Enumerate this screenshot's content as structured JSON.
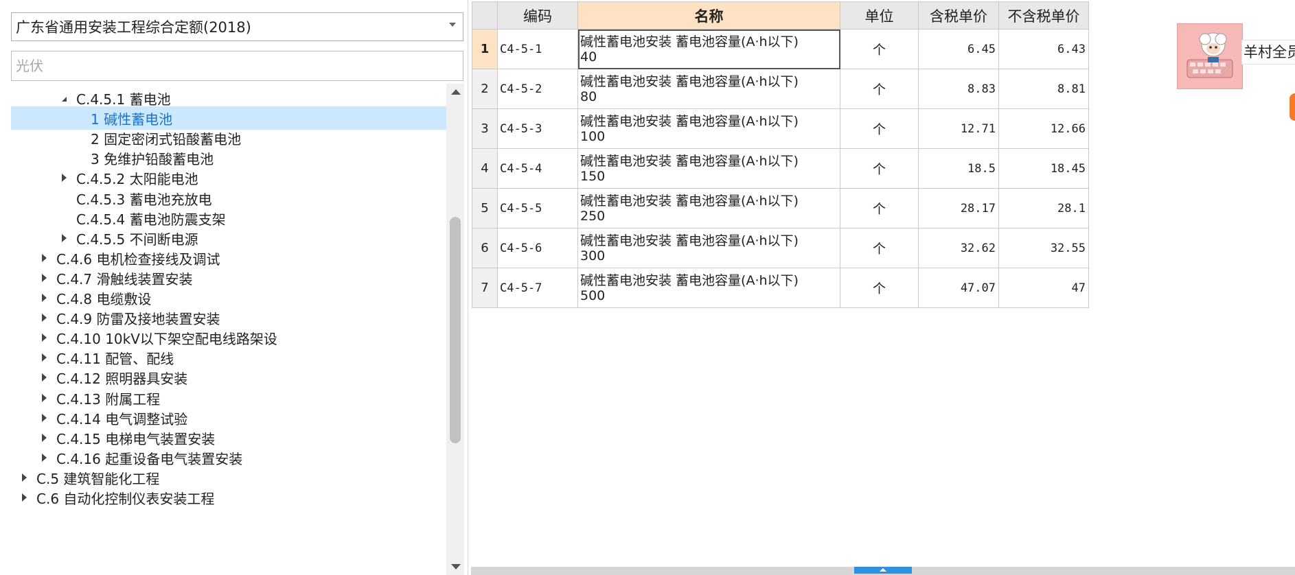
{
  "library_select": {
    "value": "广东省通用安装工程综合定额(2018)"
  },
  "search": {
    "placeholder": "光伏",
    "value": ""
  },
  "tree": {
    "items": [
      {
        "label": "C.4.5.1 蓄电池",
        "level": 2,
        "state": "expanded"
      },
      {
        "label": "1 碱性蓄电池",
        "level": 3,
        "state": "none",
        "selected": true
      },
      {
        "label": "2 固定密闭式铅酸蓄电池",
        "level": 3,
        "state": "none"
      },
      {
        "label": "3 免维护铅酸蓄电池",
        "level": 3,
        "state": "none"
      },
      {
        "label": "C.4.5.2 太阳能电池",
        "level": 2,
        "state": "collapsed"
      },
      {
        "label": "C.4.5.3 蓄电池充放电",
        "level": 2,
        "state": "none"
      },
      {
        "label": "C.4.5.4 蓄电池防震支架",
        "level": 2,
        "state": "none"
      },
      {
        "label": "C.4.5.5 不间断电源",
        "level": 2,
        "state": "collapsed"
      },
      {
        "label": "C.4.6 电机检查接线及调试",
        "level": 1,
        "state": "collapsed"
      },
      {
        "label": "C.4.7 滑触线装置安装",
        "level": 1,
        "state": "collapsed"
      },
      {
        "label": "C.4.8 电缆敷设",
        "level": 1,
        "state": "collapsed"
      },
      {
        "label": "C.4.9 防雷及接地装置安装",
        "level": 1,
        "state": "collapsed"
      },
      {
        "label": "C.4.10 10kV以下架空配电线路架设",
        "level": 1,
        "state": "collapsed"
      },
      {
        "label": "C.4.11 配管、配线",
        "level": 1,
        "state": "collapsed"
      },
      {
        "label": "C.4.12 照明器具安装",
        "level": 1,
        "state": "collapsed"
      },
      {
        "label": "C.4.13 附属工程",
        "level": 1,
        "state": "collapsed"
      },
      {
        "label": "C.4.14 电气调整试验",
        "level": 1,
        "state": "collapsed"
      },
      {
        "label": "C.4.15 电梯电气装置安装",
        "level": 1,
        "state": "collapsed"
      },
      {
        "label": "C.4.16 起重设备电气装置安装",
        "level": 1,
        "state": "collapsed"
      },
      {
        "label": "C.5 建筑智能化工程",
        "level": 0,
        "state": "collapsed"
      },
      {
        "label": "C.6 自动化控制仪表安装工程",
        "level": 0,
        "state": "collapsed"
      }
    ]
  },
  "table": {
    "columns": [
      "",
      "编码",
      "名称",
      "单位",
      "含税单价",
      "不含税单价"
    ],
    "rows": [
      {
        "num": "1",
        "code": "C4-5-1",
        "name_line1": "碱性蓄电池安装 蓄电池容量(A·h以下)",
        "name_line2": "40",
        "unit": "个",
        "price_tax": "6.45",
        "price_notax": "6.43"
      },
      {
        "num": "2",
        "code": "C4-5-2",
        "name_line1": "碱性蓄电池安装 蓄电池容量(A·h以下)",
        "name_line2": "80",
        "unit": "个",
        "price_tax": "8.83",
        "price_notax": "8.81"
      },
      {
        "num": "3",
        "code": "C4-5-3",
        "name_line1": "碱性蓄电池安装 蓄电池容量(A·h以下)",
        "name_line2": "100",
        "unit": "个",
        "price_tax": "12.71",
        "price_notax": "12.66"
      },
      {
        "num": "4",
        "code": "C4-5-4",
        "name_line1": "碱性蓄电池安装 蓄电池容量(A·h以下)",
        "name_line2": "150",
        "unit": "个",
        "price_tax": "18.5",
        "price_notax": "18.45"
      },
      {
        "num": "5",
        "code": "C4-5-5",
        "name_line1": "碱性蓄电池安装 蓄电池容量(A·h以下)",
        "name_line2": "250",
        "unit": "个",
        "price_tax": "28.17",
        "price_notax": "28.1"
      },
      {
        "num": "6",
        "code": "C4-5-6",
        "name_line1": "碱性蓄电池安装 蓄电池容量(A·h以下)",
        "name_line2": "300",
        "unit": "个",
        "price_tax": "32.62",
        "price_notax": "32.55"
      },
      {
        "num": "7",
        "code": "C4-5-7",
        "name_line1": "碱性蓄电池安装 蓄电池容量(A·h以下)",
        "name_line2": "500",
        "unit": "个",
        "price_tax": "47.07",
        "price_notax": "47"
      }
    ]
  },
  "floating_widget": {
    "label": "羊村全员"
  },
  "colors": {
    "selection_bg": "#cce8ff",
    "selection_text": "#1a73c9",
    "header_highlight": "#fde3c4",
    "accent_blue": "#2f8fe0",
    "avatar_pink": "#f7b8b8",
    "orange_tab": "#f27a2a"
  },
  "icons": {
    "dropdown": "chevron-down-icon",
    "tree_expanded": "triangle-expanded-icon",
    "tree_collapsed": "triangle-collapsed-icon",
    "avatar": "sheep-keyboard-avatar-icon"
  }
}
